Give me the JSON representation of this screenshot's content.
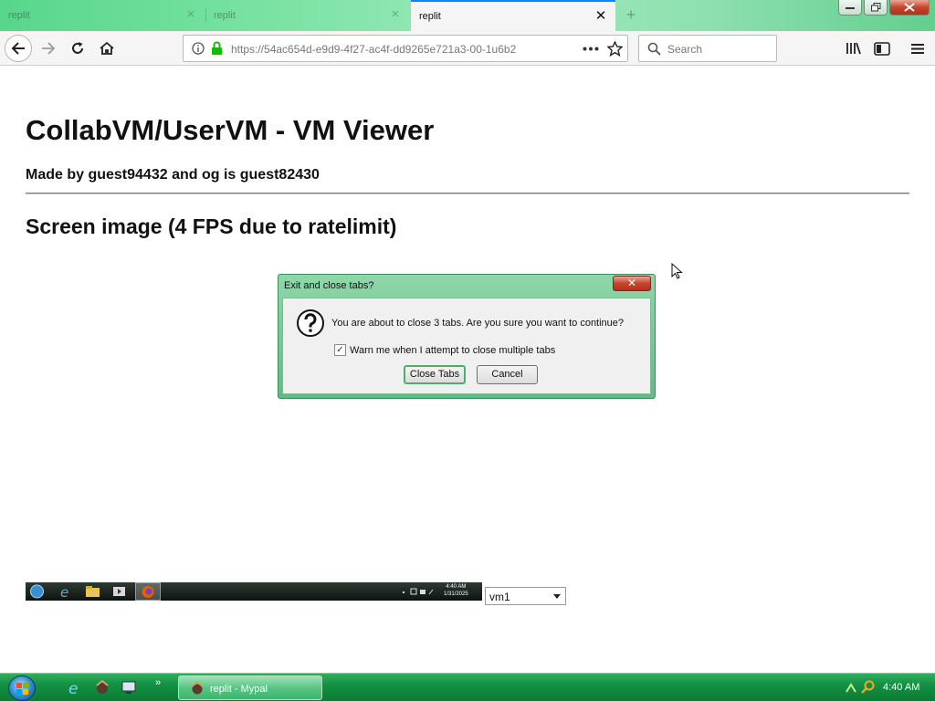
{
  "browser": {
    "tabs": [
      {
        "title": "replit",
        "active": false
      },
      {
        "title": "replit",
        "active": false
      },
      {
        "title": "replit",
        "active": true
      }
    ],
    "url": "https://54ac654d-e9d9-4f27-ac4f-dd9265e721a3-00-1u6b2",
    "search_placeholder": "Search"
  },
  "page": {
    "title": "CollabVM/UserVM - VM Viewer",
    "made_by": "Made by guest94432 and og is guest82430",
    "subtitle": "Screen image (4 FPS due to ratelimit)"
  },
  "dialog": {
    "title": "Exit and close tabs?",
    "close_glyph": "✕",
    "message": "You are about to close 3 tabs. Are you sure you want to continue?",
    "checkbox_label": "Warn me when I attempt to close multiple tabs",
    "checkbox_checked": true,
    "checkbox_glyph": "✓",
    "primary_button": "Close Tabs",
    "secondary_button": "Cancel"
  },
  "vm": {
    "clock_time": "4:40 AM",
    "clock_date": "1/31/2025",
    "select_value": "vm1"
  },
  "taskbar": {
    "task_label": "replit - Mypal",
    "clock": "4:40 AM",
    "overflow_glyph": "»"
  },
  "colors": {
    "accent": "#0a84ff",
    "chrome_green": "#62cf8e",
    "taskbar_green": "#139143",
    "close_red": "#c7432b"
  }
}
